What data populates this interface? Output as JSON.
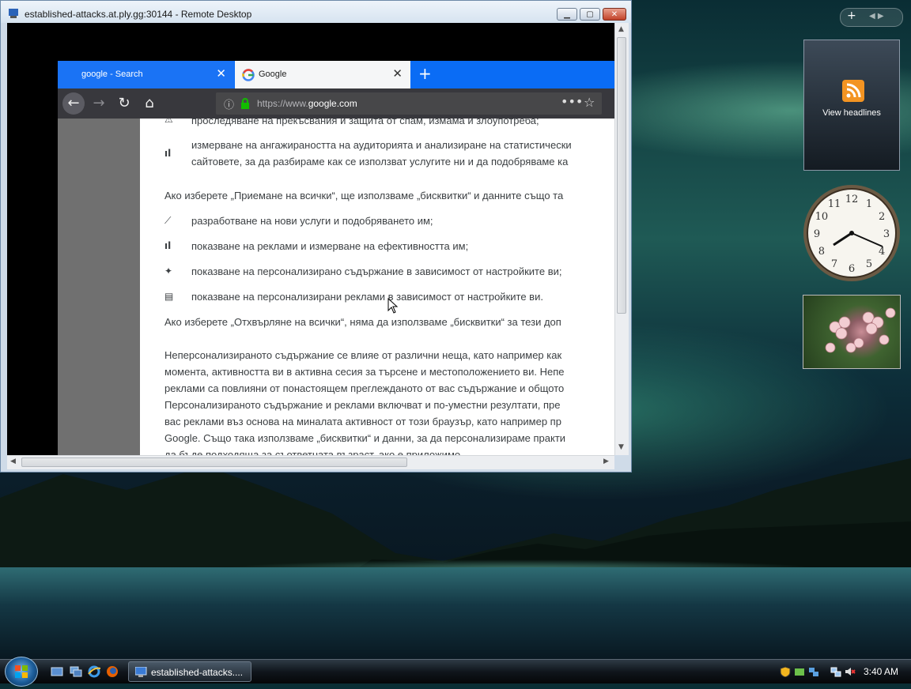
{
  "rdp": {
    "title": "established-attacks.at.ply.gg:30144 - Remote Desktop"
  },
  "browser": {
    "tabs": [
      {
        "label": "google - Search"
      },
      {
        "label": "Google"
      }
    ],
    "url_prefix": "https://www.",
    "url_domain": "google.com",
    "content_lines": [
      {
        "icon": "warning-icon",
        "text": "проследяване на прекъсвания и защита от спам, измама и злоупотреба;"
      },
      {
        "icon": "bar-chart-icon",
        "text": "измерване на ангажираността на аудиторията и анализиране на статистически"
      },
      {
        "icon": "",
        "text": "сайтовете, за да разбираме как се използват услугите ни и да подобряваме ка"
      },
      {
        "icon": "",
        "text": "Ако изберете „Приемане на всички“, ще използваме „бисквитки“ и данните също та"
      },
      {
        "icon": "trending-icon",
        "text": "разработване на нови услуги и подобряването им;"
      },
      {
        "icon": "bar-chart-icon",
        "text": "показване на реклами и измерване на ефективността им;"
      },
      {
        "icon": "sparkle-icon",
        "text": "показване на персонализирано съдържание в зависимост от настройките ви;"
      },
      {
        "icon": "ad-icon",
        "text": "показване на персонализирани реклами в зависимост от настройките ви."
      },
      {
        "icon": "",
        "text": "Ако изберете „Отхвърляне на всички“, няма да използваме „бисквитки“ за тези доп"
      },
      {
        "icon": "",
        "text": "Неперсонализираното съдържание се влияе от различни неща, като например как"
      },
      {
        "icon": "",
        "text": "момента, активността ви в активна сесия за търсене и местоположението ви. Непе"
      },
      {
        "icon": "",
        "text": "реклами са повлияни от понастоящем преглежданото от вас съдържание и общото"
      },
      {
        "icon": "",
        "text": "Персонализираното съдържание и реклами включват и по-уместни резултати, пре"
      },
      {
        "icon": "",
        "text": "вас реклами въз основа на миналата активност от този браузър, като например пр"
      },
      {
        "icon": "",
        "text": "Google. Също така използваме „бисквитки“ и данни, за да персонализираме практи"
      },
      {
        "icon": "",
        "text": "да бъде подходяща за съответната възраст, ако е приложимо."
      }
    ]
  },
  "gadgets": {
    "feed_label": "View headlines",
    "clock_numbers": [
      "12",
      "1",
      "2",
      "3",
      "4",
      "5",
      "6",
      "7",
      "8",
      "9",
      "10",
      "11"
    ]
  },
  "taskbar": {
    "task_label": "established-attacks....",
    "time": "3:40 AM"
  },
  "colors": {
    "tab_bar": "#0a6cf5",
    "nav_bar": "#38383d",
    "rss": "#f39422"
  }
}
